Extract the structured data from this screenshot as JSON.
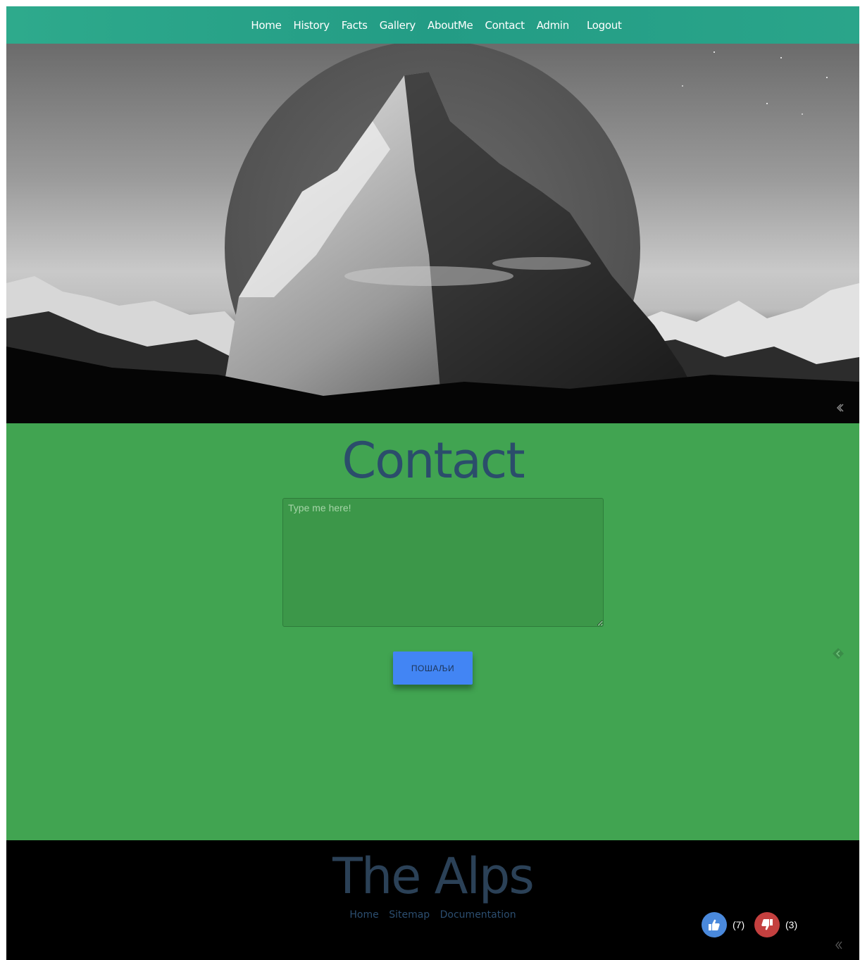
{
  "nav": {
    "items": [
      {
        "label": "Home"
      },
      {
        "label": "History"
      },
      {
        "label": "Facts"
      },
      {
        "label": "Gallery"
      },
      {
        "label": "AboutMe"
      },
      {
        "label": "Contact"
      },
      {
        "label": "Admin"
      }
    ],
    "logout_label": "Logout"
  },
  "hero": {
    "image": "mountain-peak-grayscale",
    "icon": "chevron-left-icon"
  },
  "contact": {
    "title": "Contact",
    "message_placeholder": "Type me here!",
    "message_value": "",
    "send_label": "ПОШАЉИ",
    "side_icon": "chevron-left-icon"
  },
  "footer": {
    "title": "The Alps",
    "links": [
      {
        "label": "Home"
      },
      {
        "label": "Sitemap"
      },
      {
        "label": "Documentation"
      }
    ],
    "likes": {
      "icon": "thumbs-up-icon",
      "count": "(7)"
    },
    "dislikes": {
      "icon": "thumbs-down-icon",
      "count": "(3)"
    },
    "corner_icon": "chevron-left-icon"
  },
  "colors": {
    "nav_bg": "#239c85",
    "contact_bg": "#41a451",
    "title_color": "#2b4d6b",
    "button_bg": "#4285f4",
    "footer_bg": "#000000",
    "like_bg": "#4a89dc",
    "dislike_bg": "#c4403f"
  }
}
